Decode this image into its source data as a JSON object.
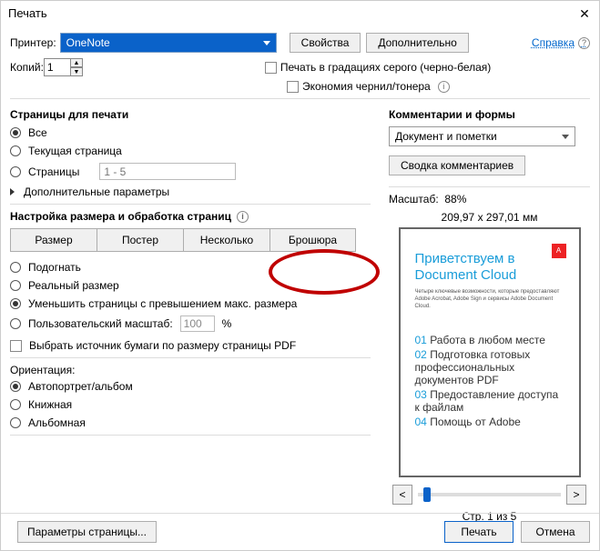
{
  "title": "Печать",
  "help_link": "Справка",
  "printer": {
    "label": "Принтер:",
    "value": "OneNote"
  },
  "buttons": {
    "properties": "Свойства",
    "advanced": "Дополнительно",
    "summary_comments": "Сводка комментариев",
    "page_setup": "Параметры страницы...",
    "print": "Печать",
    "cancel": "Отмена"
  },
  "copies": {
    "label": "Копий:",
    "value": "1"
  },
  "checks": {
    "grayscale": "Печать в градациях серого (черно-белая)",
    "save_ink": "Экономия чернил/тонера",
    "paper_source": "Выбрать источник бумаги по размеру страницы PDF",
    "more_options": "Дополнительные параметры"
  },
  "pages": {
    "title": "Страницы для печати",
    "all": "Все",
    "current": "Текущая страница",
    "range": "Страницы",
    "range_placeholder": "1 - 5"
  },
  "sizing": {
    "title": "Настройка размера и обработка страниц",
    "size": "Размер",
    "poster": "Постер",
    "multiple": "Несколько",
    "booklet": "Брошюра",
    "fit": "Подогнать",
    "actual": "Реальный размер",
    "shrink": "Уменьшить страницы с превышением макс. размера",
    "custom": "Пользовательский масштаб:",
    "custom_val": "100",
    "pct": "%"
  },
  "orientation": {
    "title": "Ориентация:",
    "auto": "Автопортрет/альбом",
    "portrait": "Книжная",
    "landscape": "Альбомная"
  },
  "comments": {
    "title": "Комментарии и формы",
    "value": "Документ и пометки"
  },
  "scale": {
    "label": "Масштаб:",
    "value": "88%"
  },
  "paper_dim": "209,97 x 297,01 мм",
  "preview": {
    "title": "Приветствуем в Document Cloud",
    "sub": "Четыре ключевые возможности, которые предоставляют Adobe Acrobat, Adobe Sign и сервисы Adobe Document Cloud.",
    "items": [
      {
        "n": "01",
        "t": "Работа в любом месте"
      },
      {
        "n": "02",
        "t": "Подготовка готовых профессиональных документов PDF"
      },
      {
        "n": "03",
        "t": "Предоставление доступа к файлам"
      },
      {
        "n": "04",
        "t": "Помощь от Adobe"
      }
    ]
  },
  "pager": "Стр. 1 из 5"
}
